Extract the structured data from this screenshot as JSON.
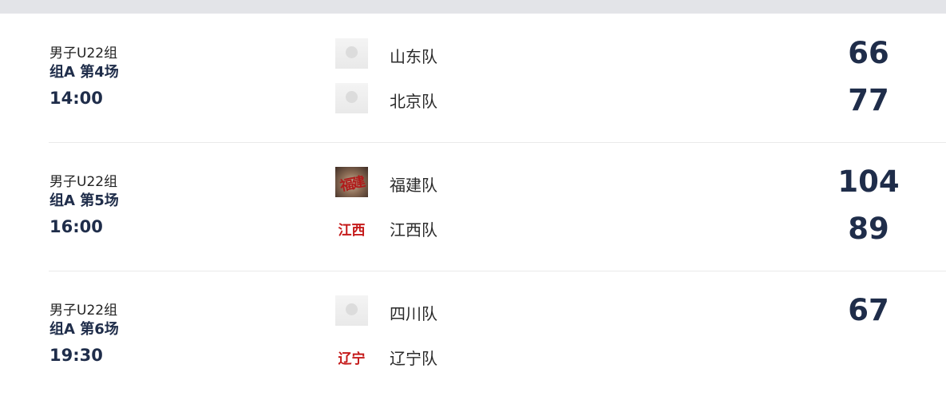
{
  "games": [
    {
      "category": "男子U22组",
      "round": "组A 第4场",
      "time": "14:00",
      "home": {
        "name": "山东队",
        "logo": "placeholder-logo",
        "score": "66"
      },
      "away": {
        "name": "北京队",
        "logo": "placeholder-logo",
        "score": "77"
      }
    },
    {
      "category": "男子U22组",
      "round": "组A 第5场",
      "time": "16:00",
      "home": {
        "name": "福建队",
        "logo": "fujian-calligraphy-logo",
        "logo_text": "福建",
        "score": "104"
      },
      "away": {
        "name": "江西队",
        "logo": "jiangxi-text-logo",
        "logo_text": "江西",
        "score": "89"
      }
    },
    {
      "category": "男子U22组",
      "round": "组A 第6场",
      "time": "19:30",
      "home": {
        "name": "四川队",
        "logo": "placeholder-logo",
        "score": "67"
      },
      "away": {
        "name": "辽宁队",
        "logo": "liaoning-text-logo",
        "logo_text": "辽宁",
        "score": ""
      }
    }
  ],
  "colors": {
    "score": "#1f2d4a",
    "topbar": "#e3e4e8",
    "logo_red": "#c51a1a"
  }
}
